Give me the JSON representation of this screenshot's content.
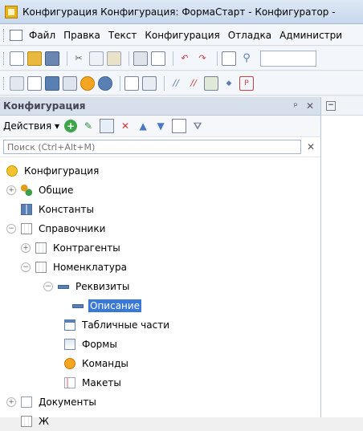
{
  "window": {
    "title": "Конфигурация Конфигурация: ФормаСтарт - Конфигуратор - "
  },
  "menubar": {
    "items": [
      "Файл",
      "Правка",
      "Текст",
      "Конфигурация",
      "Отладка",
      "Администри"
    ]
  },
  "panel": {
    "title": "Конфигурация",
    "pin": "ᵖ",
    "close": "✕",
    "actions_label": "Действия ▾",
    "search_placeholder": "Поиск (Ctrl+Alt+M)",
    "search_clear": "✕"
  },
  "tree": {
    "root": "Конфигурация",
    "common": "Общие",
    "constants": "Константы",
    "catalogs": "Справочники",
    "counterparties": "Контрагенты",
    "nomenclature": "Номенклатура",
    "attributes": "Реквизиты",
    "description": "Описание",
    "tabular_parts": "Табличные части",
    "forms": "Формы",
    "commands": "Команды",
    "layouts": "Макеты",
    "documents": "Документы",
    "next_partial": "Ж"
  },
  "toggles": {
    "plus": "+",
    "minus": "−"
  },
  "right": {
    "collapse": "−"
  }
}
